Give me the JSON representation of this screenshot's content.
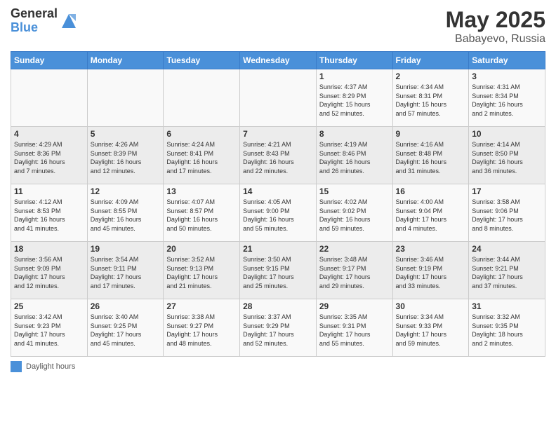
{
  "header": {
    "logo_general": "General",
    "logo_blue": "Blue",
    "main_title": "May 2025",
    "subtitle": "Babayevo, Russia"
  },
  "footer": {
    "legend_label": "Daylight hours"
  },
  "days_of_week": [
    "Sunday",
    "Monday",
    "Tuesday",
    "Wednesday",
    "Thursday",
    "Friday",
    "Saturday"
  ],
  "weeks": [
    [
      {
        "day": "",
        "info": ""
      },
      {
        "day": "",
        "info": ""
      },
      {
        "day": "",
        "info": ""
      },
      {
        "day": "",
        "info": ""
      },
      {
        "day": "1",
        "info": "Sunrise: 4:37 AM\nSunset: 8:29 PM\nDaylight: 15 hours\nand 52 minutes."
      },
      {
        "day": "2",
        "info": "Sunrise: 4:34 AM\nSunset: 8:31 PM\nDaylight: 15 hours\nand 57 minutes."
      },
      {
        "day": "3",
        "info": "Sunrise: 4:31 AM\nSunset: 8:34 PM\nDaylight: 16 hours\nand 2 minutes."
      }
    ],
    [
      {
        "day": "4",
        "info": "Sunrise: 4:29 AM\nSunset: 8:36 PM\nDaylight: 16 hours\nand 7 minutes."
      },
      {
        "day": "5",
        "info": "Sunrise: 4:26 AM\nSunset: 8:39 PM\nDaylight: 16 hours\nand 12 minutes."
      },
      {
        "day": "6",
        "info": "Sunrise: 4:24 AM\nSunset: 8:41 PM\nDaylight: 16 hours\nand 17 minutes."
      },
      {
        "day": "7",
        "info": "Sunrise: 4:21 AM\nSunset: 8:43 PM\nDaylight: 16 hours\nand 22 minutes."
      },
      {
        "day": "8",
        "info": "Sunrise: 4:19 AM\nSunset: 8:46 PM\nDaylight: 16 hours\nand 26 minutes."
      },
      {
        "day": "9",
        "info": "Sunrise: 4:16 AM\nSunset: 8:48 PM\nDaylight: 16 hours\nand 31 minutes."
      },
      {
        "day": "10",
        "info": "Sunrise: 4:14 AM\nSunset: 8:50 PM\nDaylight: 16 hours\nand 36 minutes."
      }
    ],
    [
      {
        "day": "11",
        "info": "Sunrise: 4:12 AM\nSunset: 8:53 PM\nDaylight: 16 hours\nand 41 minutes."
      },
      {
        "day": "12",
        "info": "Sunrise: 4:09 AM\nSunset: 8:55 PM\nDaylight: 16 hours\nand 45 minutes."
      },
      {
        "day": "13",
        "info": "Sunrise: 4:07 AM\nSunset: 8:57 PM\nDaylight: 16 hours\nand 50 minutes."
      },
      {
        "day": "14",
        "info": "Sunrise: 4:05 AM\nSunset: 9:00 PM\nDaylight: 16 hours\nand 55 minutes."
      },
      {
        "day": "15",
        "info": "Sunrise: 4:02 AM\nSunset: 9:02 PM\nDaylight: 16 hours\nand 59 minutes."
      },
      {
        "day": "16",
        "info": "Sunrise: 4:00 AM\nSunset: 9:04 PM\nDaylight: 17 hours\nand 4 minutes."
      },
      {
        "day": "17",
        "info": "Sunrise: 3:58 AM\nSunset: 9:06 PM\nDaylight: 17 hours\nand 8 minutes."
      }
    ],
    [
      {
        "day": "18",
        "info": "Sunrise: 3:56 AM\nSunset: 9:09 PM\nDaylight: 17 hours\nand 12 minutes."
      },
      {
        "day": "19",
        "info": "Sunrise: 3:54 AM\nSunset: 9:11 PM\nDaylight: 17 hours\nand 17 minutes."
      },
      {
        "day": "20",
        "info": "Sunrise: 3:52 AM\nSunset: 9:13 PM\nDaylight: 17 hours\nand 21 minutes."
      },
      {
        "day": "21",
        "info": "Sunrise: 3:50 AM\nSunset: 9:15 PM\nDaylight: 17 hours\nand 25 minutes."
      },
      {
        "day": "22",
        "info": "Sunrise: 3:48 AM\nSunset: 9:17 PM\nDaylight: 17 hours\nand 29 minutes."
      },
      {
        "day": "23",
        "info": "Sunrise: 3:46 AM\nSunset: 9:19 PM\nDaylight: 17 hours\nand 33 minutes."
      },
      {
        "day": "24",
        "info": "Sunrise: 3:44 AM\nSunset: 9:21 PM\nDaylight: 17 hours\nand 37 minutes."
      }
    ],
    [
      {
        "day": "25",
        "info": "Sunrise: 3:42 AM\nSunset: 9:23 PM\nDaylight: 17 hours\nand 41 minutes."
      },
      {
        "day": "26",
        "info": "Sunrise: 3:40 AM\nSunset: 9:25 PM\nDaylight: 17 hours\nand 45 minutes."
      },
      {
        "day": "27",
        "info": "Sunrise: 3:38 AM\nSunset: 9:27 PM\nDaylight: 17 hours\nand 48 minutes."
      },
      {
        "day": "28",
        "info": "Sunrise: 3:37 AM\nSunset: 9:29 PM\nDaylight: 17 hours\nand 52 minutes."
      },
      {
        "day": "29",
        "info": "Sunrise: 3:35 AM\nSunset: 9:31 PM\nDaylight: 17 hours\nand 55 minutes."
      },
      {
        "day": "30",
        "info": "Sunrise: 3:34 AM\nSunset: 9:33 PM\nDaylight: 17 hours\nand 59 minutes."
      },
      {
        "day": "31",
        "info": "Sunrise: 3:32 AM\nSunset: 9:35 PM\nDaylight: 18 hours\nand 2 minutes."
      }
    ]
  ]
}
